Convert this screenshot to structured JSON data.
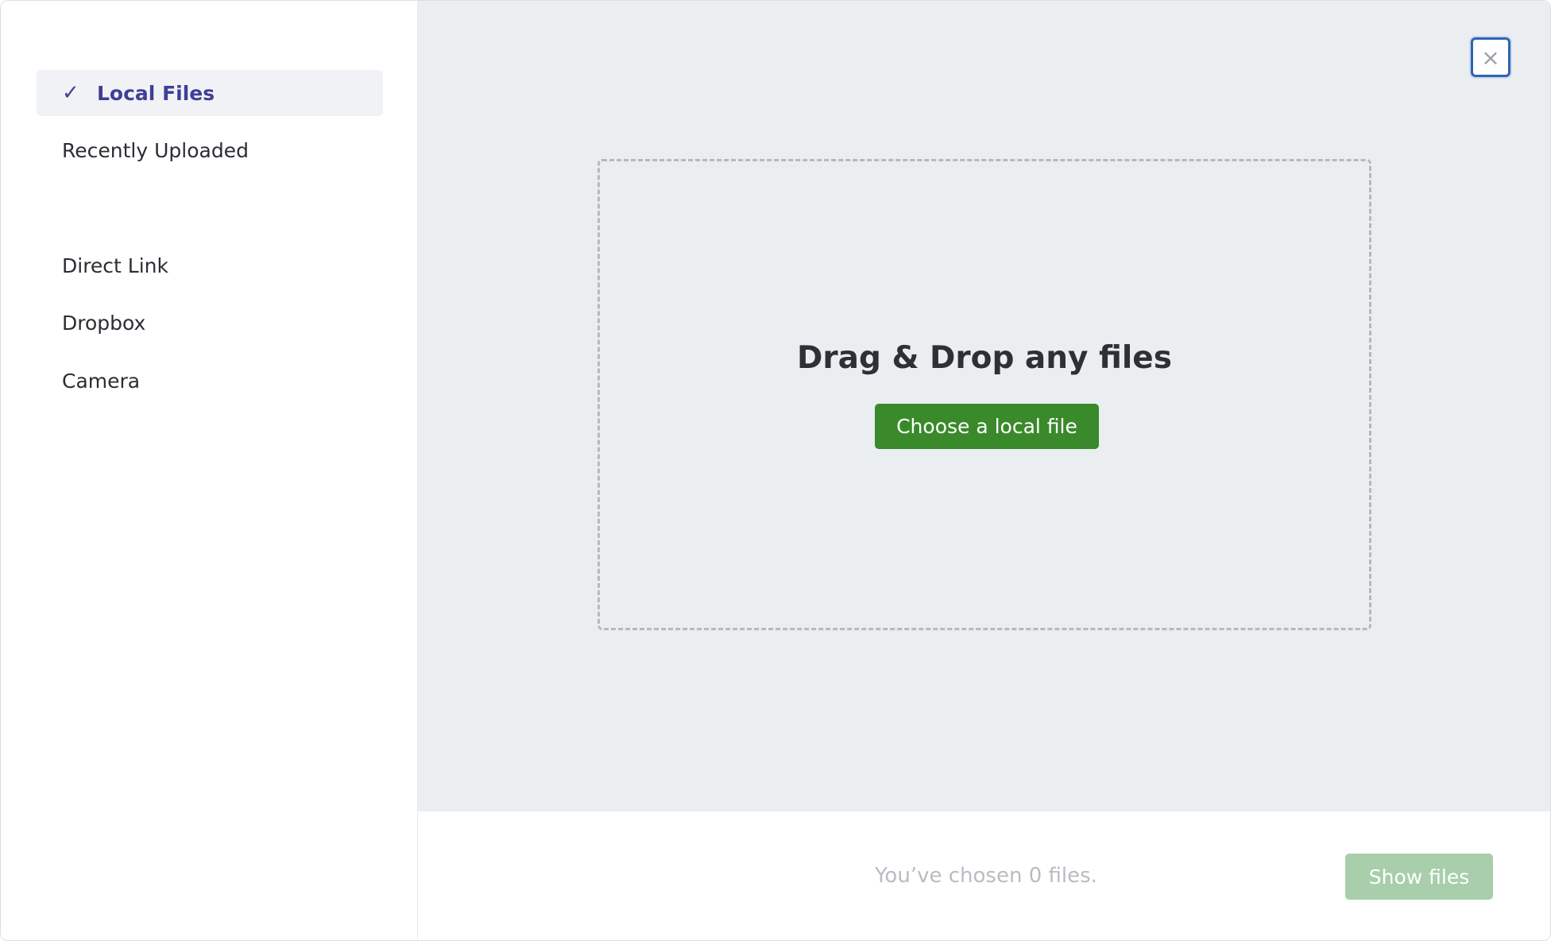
{
  "sidebar": {
    "items": [
      {
        "label": "Local Files",
        "active": true,
        "check": "✓"
      },
      {
        "label": "Recently Uploaded"
      },
      {
        "label": "Direct Link"
      },
      {
        "label": "Dropbox"
      },
      {
        "label": "Camera"
      }
    ]
  },
  "dialog": {
    "close_icon": "×"
  },
  "dropzone": {
    "title": "Drag & Drop any files",
    "choose_label": "Choose a local file"
  },
  "footer": {
    "status": "You’ve chosen 0 files.",
    "show_label": "Show files"
  },
  "colors": {
    "accent": "#3f3f96",
    "primary_button": "#3a8a2b",
    "disabled_button": "#a8ceab",
    "focus_ring": "#2f63b5"
  }
}
